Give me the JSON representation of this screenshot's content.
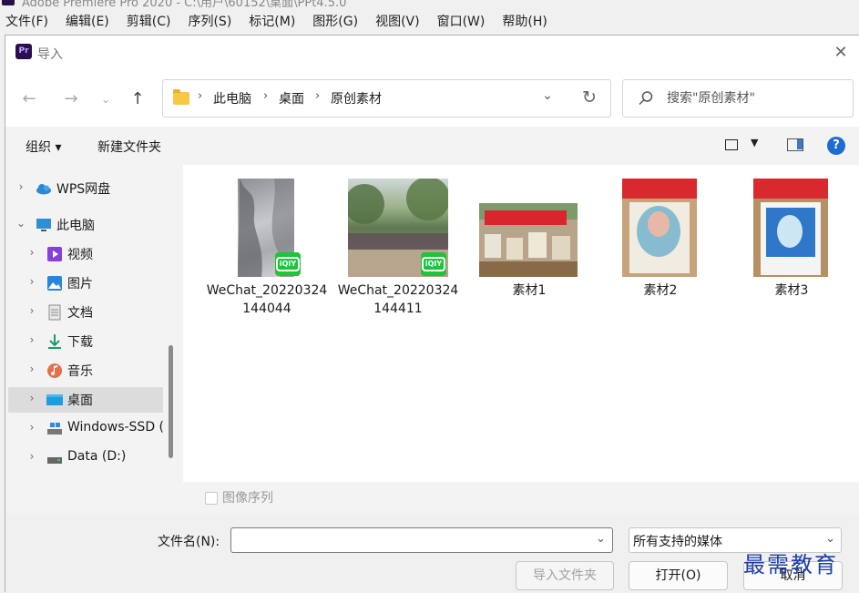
{
  "app": {
    "title": "Adobe Premiere Pro 2020 - C:\\用户\\60152\\桌面\\PPt4.5.0",
    "menu": [
      "文件(F)",
      "编辑(E)",
      "剪辑(C)",
      "序列(S)",
      "标记(M)",
      "图形(G)",
      "视图(V)",
      "窗口(W)",
      "帮助(H)"
    ]
  },
  "dialog": {
    "title": "导入",
    "icon_text": "Pr",
    "breadcrumb": [
      "此电脑",
      "桌面",
      "原创素材"
    ],
    "search_placeholder": "搜索\"原创素材\"",
    "toolbar": {
      "organize": "组织 ▾",
      "new_folder": "新建文件夹"
    },
    "nav_tree": [
      {
        "label": "WPS网盘",
        "icon": "cloud-icon"
      },
      {
        "label": "此电脑",
        "icon": "computer-icon"
      },
      {
        "label": "视频",
        "icon": "video-icon"
      },
      {
        "label": "图片",
        "icon": "picture-icon"
      },
      {
        "label": "文档",
        "icon": "document-icon"
      },
      {
        "label": "下载",
        "icon": "download-icon"
      },
      {
        "label": "音乐",
        "icon": "music-icon"
      },
      {
        "label": "桌面",
        "icon": "desktop-icon"
      },
      {
        "label": "Windows-SSD (",
        "icon": "drive-icon"
      },
      {
        "label": "Data (D:)",
        "icon": "drive-icon"
      }
    ],
    "files": [
      {
        "name": "WeChat_20220324144044",
        "type": "video"
      },
      {
        "name": "WeChat_20220324144411",
        "type": "video"
      },
      {
        "name": "素材1",
        "type": "image"
      },
      {
        "name": "素材2",
        "type": "image"
      },
      {
        "name": "素材3",
        "type": "image"
      }
    ],
    "image_sequence_label": "图像序列",
    "file_name_label": "文件名(N):",
    "file_name_value": "",
    "filter_value": "所有支持的媒体",
    "buttons": {
      "import_folder": "导入文件夹",
      "open": "打开(O)",
      "cancel": "取消"
    },
    "watermark": "最需教育",
    "colors": {
      "accent": "#1e6ccf",
      "iqiyi": "#1ec43a",
      "folder": "#f8c845"
    }
  }
}
